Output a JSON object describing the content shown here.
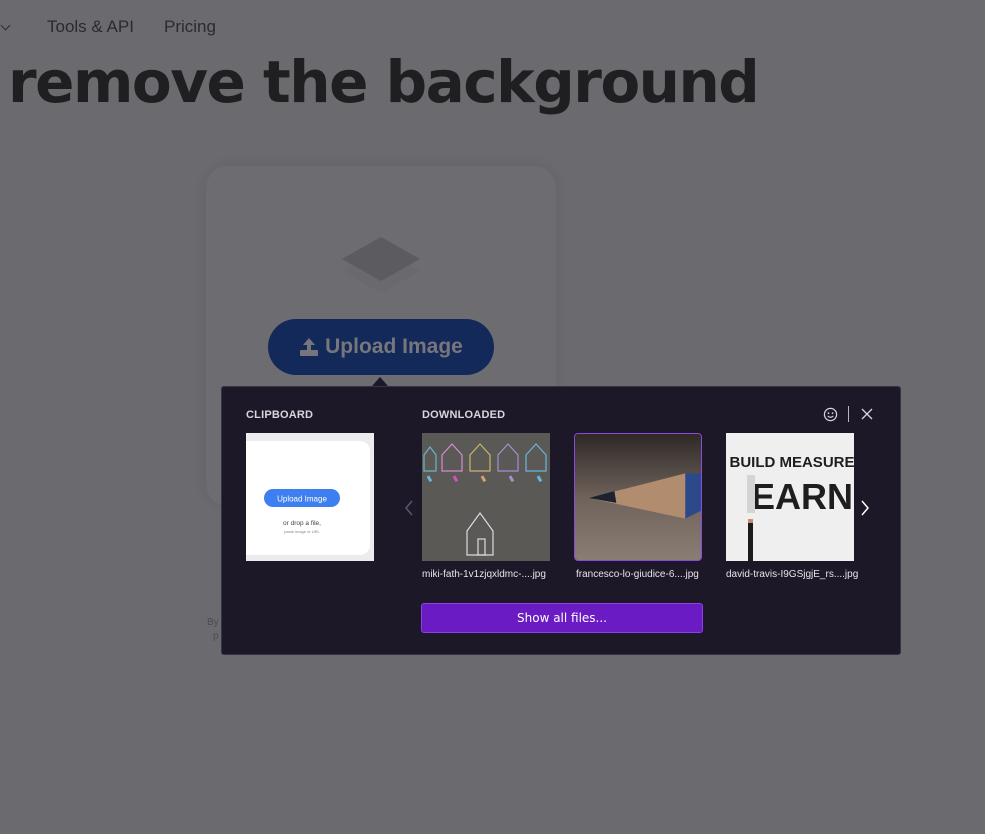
{
  "nav": {
    "items": [
      {
        "label": "Tools & API"
      },
      {
        "label": "Pricing"
      }
    ]
  },
  "hero": {
    "title": "remove the background"
  },
  "upload_card": {
    "button_label": "Upload Image",
    "terms_line1": "By",
    "terms_line2": "p"
  },
  "popup": {
    "clipboard_label": "CLIPBOARD",
    "downloaded_label": "DOWNLOADED",
    "clipboard_preview": {
      "button_label": "Upload Image",
      "drop_text": "or drop a file,",
      "paste_text": "paste image or URL"
    },
    "files": [
      {
        "name": "miki-fath-1v1zjqxldmc-....jpg",
        "selected": false
      },
      {
        "name": "francesco-lo-giudice-6....jpg",
        "selected": true
      },
      {
        "name": "david-travis-I9GSjgjE_rs....jpg",
        "selected": false
      }
    ],
    "third_thumb_text": {
      "line1": "BUILD MEASURE",
      "line2": "EARN"
    },
    "show_all_label": "Show all files...",
    "accent_color": "#6a1bc4"
  }
}
